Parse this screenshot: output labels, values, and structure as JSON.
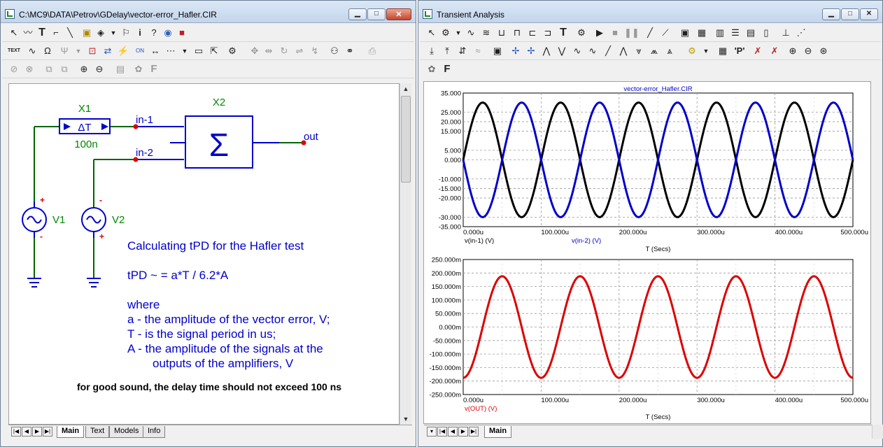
{
  "left_window": {
    "title": "C:\\MC9\\DATA\\Petrov\\GDelay\\vector-error_Hafler.CIR",
    "tabs": [
      {
        "label": "Main",
        "active": true
      },
      {
        "label": "Text",
        "active": false
      },
      {
        "label": "Models",
        "active": false
      },
      {
        "label": "Info",
        "active": false
      }
    ],
    "toolbar_row2_text_label": "TEXT",
    "toolbar_row3_font_label": "F"
  },
  "right_window": {
    "title": "Transient Analysis",
    "tabs": [
      {
        "label": "Main",
        "active": true
      }
    ],
    "toolbar_t_label": "T",
    "toolbar_p_label": "'P'",
    "toolbar_font_label": "F"
  },
  "schematic": {
    "x1_label": "X1",
    "x1_symbol": "ΔT",
    "x1_value": "100n",
    "x2_label": "X2",
    "x2_symbol": "Σ",
    "node_in1": "in-1",
    "node_in2": "in-2",
    "node_out": "out",
    "v1_label": "V1",
    "v2_label": "V2",
    "plus": "+",
    "minus": "-",
    "text_lines": [
      "Calculating tPD for the Hafler test",
      "tPD ~ = a*T / 6.2*A",
      "where",
      "a - the amplitude of the vector error, V;",
      "T - is the signal period in us;",
      "A - the amplitude of the signals at the",
      "outputs of the amplifiers, V"
    ],
    "note": "for good sound, the delay time should not exceed 100 ns",
    "colors": {
      "wire": "#006600",
      "component": "#0000cc",
      "text": "#0000cc",
      "node": "#dd0000",
      "label": "#008800"
    }
  },
  "chart_data": [
    {
      "type": "line",
      "title": "vector-error_Hafler.CIR",
      "xlabel": "T (Secs)",
      "xlim": [
        0,
        500
      ],
      "x_unit": "u",
      "ylim": [
        -35,
        35
      ],
      "x_ticks": [
        "0.000u",
        "100.000u",
        "200.000u",
        "300.000u",
        "400.000u",
        "500.000u"
      ],
      "y_ticks": [
        "35.000",
        "25.000",
        "20.000",
        "15.000",
        "5.000",
        "0.000",
        "-10.000",
        "-15.000",
        "-20.000",
        "-30.000",
        "-35.000"
      ],
      "y_tick_values": [
        35,
        25,
        20,
        15,
        5,
        0,
        -10,
        -15,
        -20,
        -30,
        -35
      ],
      "grid": true,
      "series": [
        {
          "name": "v(in-1) (V)",
          "color": "#000000",
          "amplitude": 30,
          "period": 100,
          "phase": 0,
          "sign": 1
        },
        {
          "name": "v(in-2) (V)",
          "color": "#0000cc",
          "amplitude": 30,
          "period": 100,
          "phase": 0,
          "sign": -1
        }
      ]
    },
    {
      "type": "line",
      "xlabel": "T (Secs)",
      "xlim": [
        0,
        500
      ],
      "x_unit": "u",
      "ylim": [
        -250,
        250
      ],
      "x_ticks": [
        "0.000u",
        "100.000u",
        "200.000u",
        "300.000u",
        "400.000u",
        "500.000u"
      ],
      "y_ticks": [
        "250.000m",
        "200.000m",
        "150.000m",
        "100.000m",
        "50.000m",
        "0.000m",
        "-50.000m",
        "-100.000m",
        "-150.000m",
        "-200.000m",
        "-250.000m"
      ],
      "y_tick_values": [
        250,
        200,
        150,
        100,
        50,
        0,
        -50,
        -100,
        -150,
        -200,
        -250
      ],
      "grid": true,
      "series": [
        {
          "name": "v(OUT) (V)",
          "color": "#dd0000",
          "amplitude": 188,
          "period": 100,
          "phase": 25,
          "sign": 1
        }
      ]
    }
  ]
}
